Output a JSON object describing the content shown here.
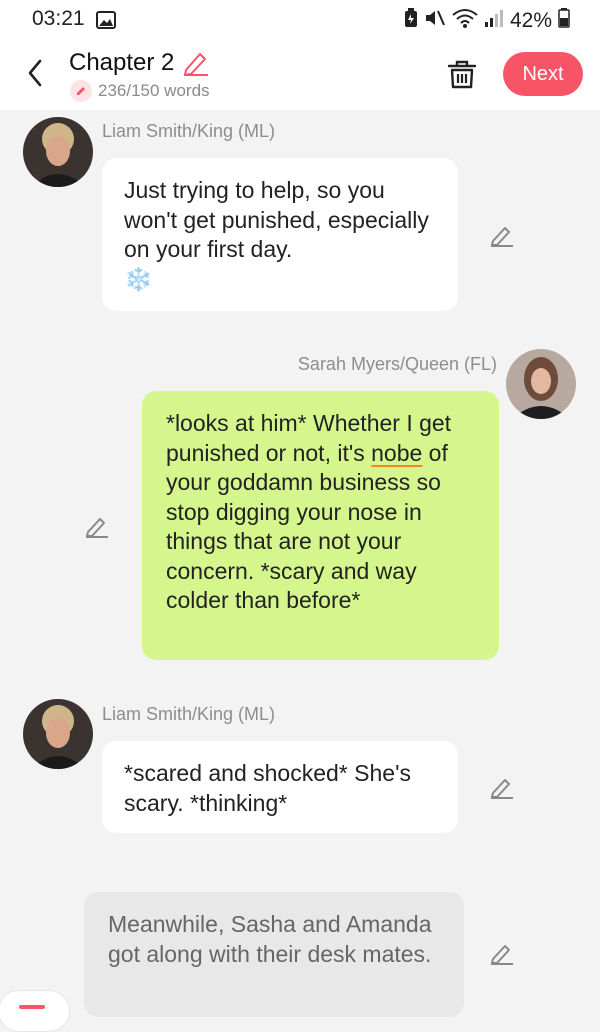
{
  "status_bar": {
    "time": "03:21",
    "battery": "42%"
  },
  "header": {
    "title": "Chapter 2",
    "word_count": "236/150 words",
    "next_label": "Next",
    "accent_color": "#f75468"
  },
  "messages": [
    {
      "speaker": "Liam Smith/King (ML)",
      "text": "Just trying to help, so you won't get punished, especially on your first day.",
      "emoji": "❄️"
    },
    {
      "speaker": "Sarah Myers/Queen (FL)",
      "text_before": "*looks at him* Whether I get punished or not, it's ",
      "misspelled_word": "nobe",
      "text_after": " of your goddamn business so stop digging your nose in things that are not your concern. *scary and way colder than before*"
    },
    {
      "speaker": "Liam Smith/King (ML)",
      "text": "*scared and shocked* She's scary. *thinking*"
    },
    {
      "text": "Meanwhile, Sasha and Amanda got along with their desk mates."
    }
  ],
  "colors": {
    "green_bubble": "#d5f68c",
    "background": "#f3f3f3"
  }
}
